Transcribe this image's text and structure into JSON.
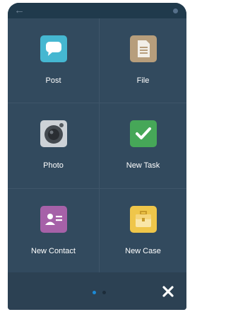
{
  "colors": {
    "post_tile": "#45b7d1",
    "file_tile": "#b79e7c",
    "photo_tile": "#cdd2d7",
    "task_tile": "#46a758",
    "contact_tile": "#a661a8",
    "case_tile": "#efc64a",
    "dot_active": "#1c8ad6",
    "dot_inactive": "#1c2c3a"
  },
  "actions": [
    {
      "label": "Post",
      "icon": "speech-bubble-icon"
    },
    {
      "label": "File",
      "icon": "document-icon"
    },
    {
      "label": "Photo",
      "icon": "camera-icon"
    },
    {
      "label": "New Task",
      "icon": "checkmark-icon"
    },
    {
      "label": "New Contact",
      "icon": "contact-card-icon"
    },
    {
      "label": "New Case",
      "icon": "briefcase-icon"
    }
  ],
  "pagination": {
    "current": 1,
    "total": 2
  },
  "footer": {
    "close_icon": "close-icon"
  },
  "top_bar": {
    "back_icon": "back-arrow-icon"
  }
}
